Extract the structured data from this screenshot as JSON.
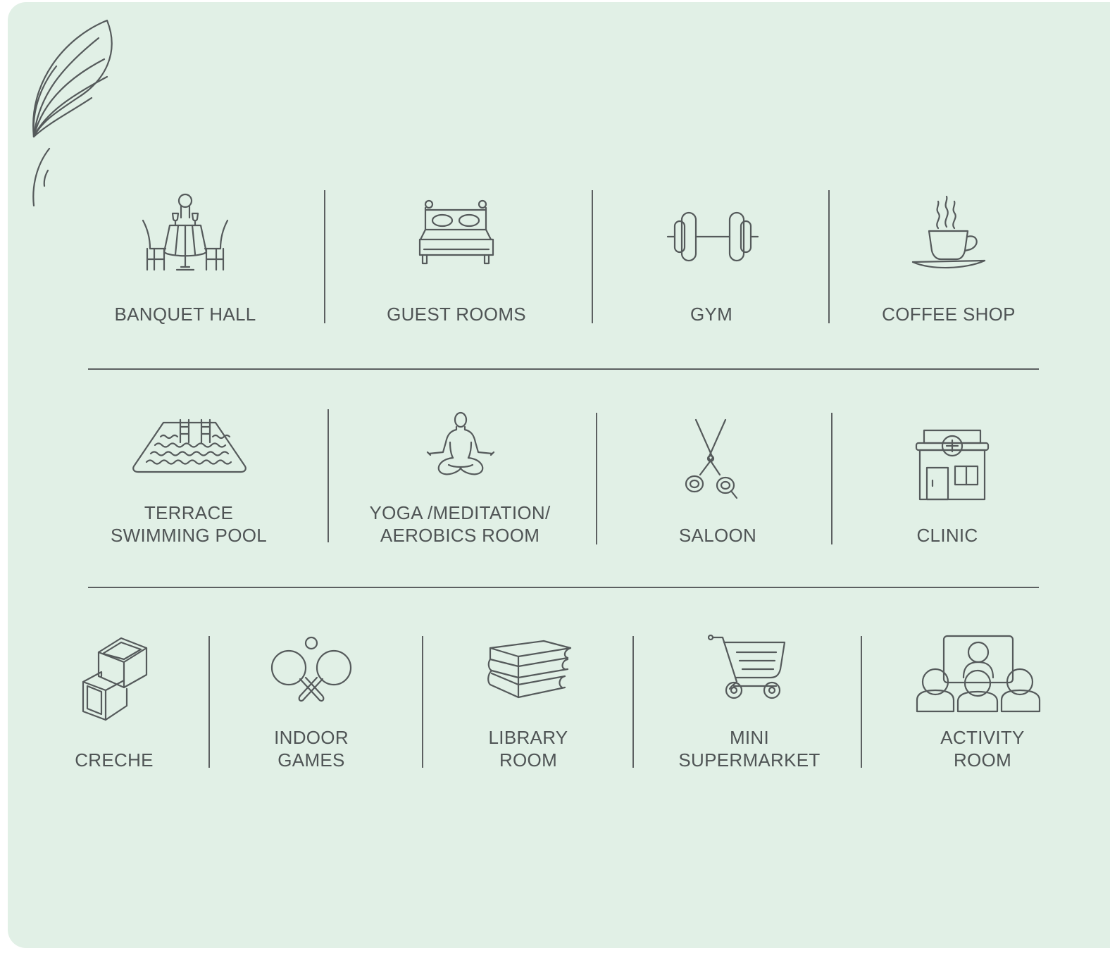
{
  "amenities": {
    "row1": [
      {
        "label": "BANQUET HALL",
        "icon": "banquet-table-icon"
      },
      {
        "label": "GUEST ROOMS",
        "icon": "bed-icon"
      },
      {
        "label": "GYM",
        "icon": "dumbbell-icon"
      },
      {
        "label": "COFFEE SHOP",
        "icon": "coffee-cup-icon"
      }
    ],
    "row2": [
      {
        "label_line1": "TERRACE",
        "label_line2": "SWIMMING POOL",
        "icon": "pool-icon"
      },
      {
        "label_line1": "YOGA /MEDITATION/",
        "label_line2": "AEROBICS ROOM",
        "icon": "meditation-icon"
      },
      {
        "label": "SALOON",
        "icon": "scissors-icon"
      },
      {
        "label": "CLINIC",
        "icon": "clinic-icon"
      }
    ],
    "row3": [
      {
        "label": "CRECHE",
        "icon": "blocks-icon"
      },
      {
        "label_line1": "INDOOR",
        "label_line2": "GAMES",
        "icon": "ping-pong-icon"
      },
      {
        "label_line1": "LIBRARY",
        "label_line2": "ROOM",
        "icon": "books-icon"
      },
      {
        "label_line1": "MINI",
        "label_line2": "SUPERMARKET",
        "icon": "shopping-cart-icon"
      },
      {
        "label_line1": "ACTIVITY",
        "label_line2": "ROOM",
        "icon": "audience-icon"
      }
    ]
  },
  "decoration": {
    "icon": "leaf-icon"
  },
  "colors": {
    "background": "#e1f0e6",
    "line": "#5c6061",
    "text": "#4f5455"
  }
}
